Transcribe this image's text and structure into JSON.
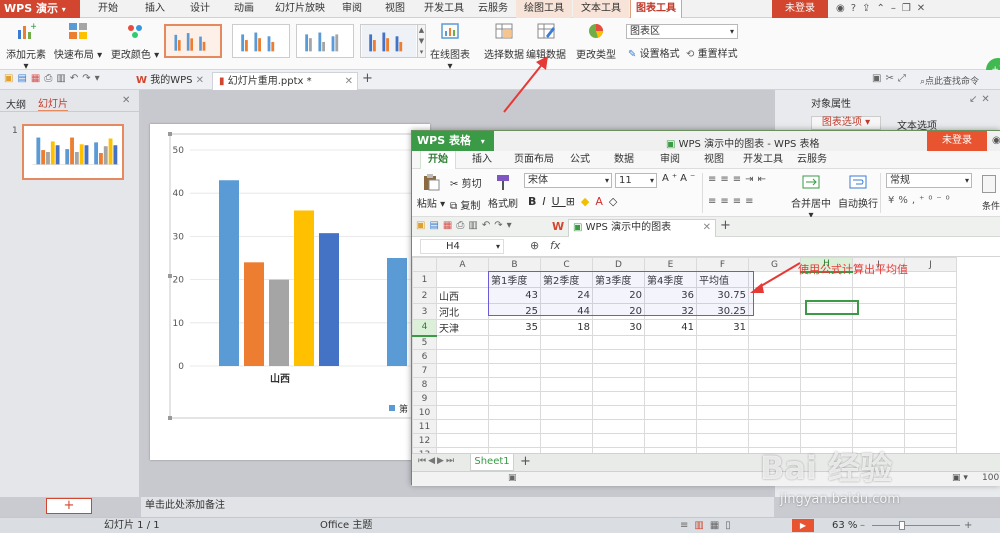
{
  "app": {
    "brand": "WPS 演示",
    "menu_tabs": [
      "开始",
      "插入",
      "设计",
      "动画",
      "幻灯片放映",
      "审阅",
      "视图",
      "开发工具",
      "云服务"
    ],
    "context_tabs": [
      "绘图工具",
      "文本工具",
      "图表工具"
    ],
    "login": "未登录"
  },
  "ribbon": {
    "add_element": "添加元素",
    "quick_layout": "快速布局",
    "change_color": "更改颜色",
    "online_chart": "在线图表",
    "select_data": "选择数据",
    "edit_data": "编辑数据",
    "change_type": "更改类型",
    "chart_area": "图表区",
    "format": "设置格式",
    "reset_style": "重置样式"
  },
  "doc_tabs": {
    "home": "我的WPS",
    "file": "幻灯片重用.pptx *",
    "search": "点此查找命令"
  },
  "left_panel": {
    "outline": "大纲",
    "slides": "幻灯片",
    "slide_number": "1"
  },
  "right_panel": {
    "title": "对象属性",
    "tab_chart": "图表选项",
    "tab_text": "文本选项"
  },
  "notes": "单击此处添加备注",
  "status": {
    "slide": "幻灯片 1 / 1",
    "theme": "Office 主题",
    "zoom": "63 %"
  },
  "annotation": "使用公式计算出平均值",
  "slide_chart": {
    "yticks": [
      "50",
      "40",
      "30",
      "20",
      "10",
      "0"
    ],
    "category": "山西",
    "legend": "第"
  },
  "chart_data": {
    "type": "bar",
    "categories": [
      "山西",
      "河北"
    ],
    "series": [
      {
        "values": [
          43,
          25
        ],
        "color": "#5b9bd5"
      },
      {
        "values": [
          24,
          44
        ],
        "color": "#ed7d31"
      },
      {
        "values": [
          20,
          20
        ],
        "color": "#a5a5a5"
      },
      {
        "values": [
          36,
          32
        ],
        "color": "#ffc000"
      },
      {
        "values": [
          30.75,
          30.25
        ],
        "color": "#4472c4"
      }
    ],
    "ylim": [
      0,
      50
    ]
  },
  "ss": {
    "brand": "WPS 表格",
    "title": "WPS 演示中的图表 - WPS 表格",
    "login": "未登录",
    "menu_tabs": [
      "开始",
      "插入",
      "页面布局",
      "公式",
      "数据",
      "审阅",
      "视图",
      "开发工具",
      "云服务"
    ],
    "paste": "粘贴",
    "cut": "剪切",
    "copy": "复制",
    "format_painter": "格式刷",
    "font": "宋体",
    "size": "11",
    "bold": "B",
    "italic": "I",
    "underline": "U",
    "merge": "合并居中",
    "wrap": "自动换行",
    "number_format": "常规",
    "cond": "条件",
    "percent": "%",
    "doc_tab": "WPS 演示中的图表",
    "cell_ref": "H4",
    "fx": "fx",
    "sheet_tab": "Sheet1",
    "zoom": "100"
  },
  "sheet": {
    "columns": [
      "A",
      "B",
      "C",
      "D",
      "E",
      "F",
      "G",
      "H",
      "I",
      "J"
    ],
    "rows": [
      [
        "",
        "第1季度",
        "第2季度",
        "第3季度",
        "第4季度",
        "平均值",
        "",
        "",
        "",
        ""
      ],
      [
        "山西",
        "43",
        "24",
        "20",
        "36",
        "30.75",
        "",
        "",
        "",
        ""
      ],
      [
        "河北",
        "25",
        "44",
        "20",
        "32",
        "30.25",
        "",
        "",
        "",
        ""
      ],
      [
        "天津",
        "35",
        "18",
        "30",
        "41",
        "31",
        "",
        "",
        "",
        ""
      ],
      [
        "",
        "",
        "",
        "",
        "",
        "",
        "",
        "",
        "",
        ""
      ],
      [
        "",
        "",
        "",
        "",
        "",
        "",
        "",
        "",
        "",
        ""
      ],
      [
        "",
        "",
        "",
        "",
        "",
        "",
        "",
        "",
        "",
        ""
      ],
      [
        "",
        "",
        "",
        "",
        "",
        "",
        "",
        "",
        "",
        ""
      ],
      [
        "",
        "",
        "",
        "",
        "",
        "",
        "",
        "",
        "",
        ""
      ],
      [
        "",
        "",
        "",
        "",
        "",
        "",
        "",
        "",
        "",
        ""
      ],
      [
        "",
        "",
        "",
        "",
        "",
        "",
        "",
        "",
        "",
        ""
      ],
      [
        "",
        "",
        "",
        "",
        "",
        "",
        "",
        "",
        "",
        ""
      ],
      [
        "",
        "",
        "",
        "",
        "",
        "",
        "",
        "",
        "",
        ""
      ],
      [
        "",
        "",
        "",
        "",
        "",
        "",
        "",
        "",
        "",
        ""
      ]
    ]
  },
  "watermark": {
    "brand": "Bai 经验",
    "url": "jingyan.baidu.com"
  }
}
